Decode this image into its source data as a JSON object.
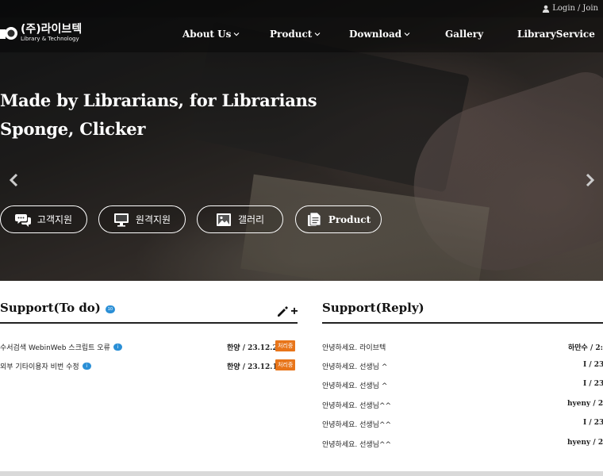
{
  "header": {
    "login": "Login",
    "separator": "/",
    "join": "Join",
    "icons": {
      "login": "person-icon"
    }
  },
  "logo": {
    "name_ko": "(주)라이브텍",
    "name_en": "Library & Technology"
  },
  "nav": {
    "items": [
      {
        "label": "About Us",
        "has_dropdown": true
      },
      {
        "label": "Product",
        "has_dropdown": true
      },
      {
        "label": "Download",
        "has_dropdown": true
      },
      {
        "label": "Gallery",
        "has_dropdown": false
      },
      {
        "label": "LibraryService",
        "has_dropdown": false
      }
    ]
  },
  "hero": {
    "line1": "Made by Librarians, for Librarians",
    "line2": "Sponge, Clicker",
    "icons": {
      "prev": "chevron-left-icon",
      "next": "chevron-right-icon"
    }
  },
  "quick_links": [
    {
      "label": "고객지원",
      "icon": "chat-bubbles-icon"
    },
    {
      "label": "원격지원",
      "icon": "monitor-icon"
    },
    {
      "label": "갤러리",
      "icon": "image-icon"
    },
    {
      "label": "Product",
      "icon": "documents-icon"
    }
  ],
  "support_todo": {
    "title": "Support(To do)",
    "count_badge": "10",
    "write_icon": "pencil-plus-icon",
    "rows": [
      {
        "title": "수서검색 WebinWeb 스크립트 오류",
        "new_badge": "i",
        "author": "한양",
        "date": "23.12.22",
        "status": "처리중"
      },
      {
        "title": "외부 기타이용자 비번 수정",
        "new_badge": "i",
        "author": "한양",
        "date": "23.12.12",
        "status": "처리중"
      }
    ]
  },
  "support_reply": {
    "title": "Support(Reply)",
    "rows": [
      {
        "title": "안녕하세요. 라이브텍",
        "meta": "하만수 / 2:"
      },
      {
        "title": "안녕하세요. 선생님 ^",
        "meta": "I / 23."
      },
      {
        "title": "안녕하세요. 선생님 ^",
        "meta": "I / 23."
      },
      {
        "title": "안녕하세요. 선생님^^",
        "meta": "hyeny / 23."
      },
      {
        "title": "안녕하세요. 선생님^^",
        "meta": "I / 23."
      },
      {
        "title": "안녕하세요. 선생님^^",
        "meta": "hyeny / 23."
      }
    ]
  },
  "colors": {
    "accent_blue": "#2a8fd6",
    "status_orange": "#e8751a",
    "text_dark": "#111111"
  }
}
